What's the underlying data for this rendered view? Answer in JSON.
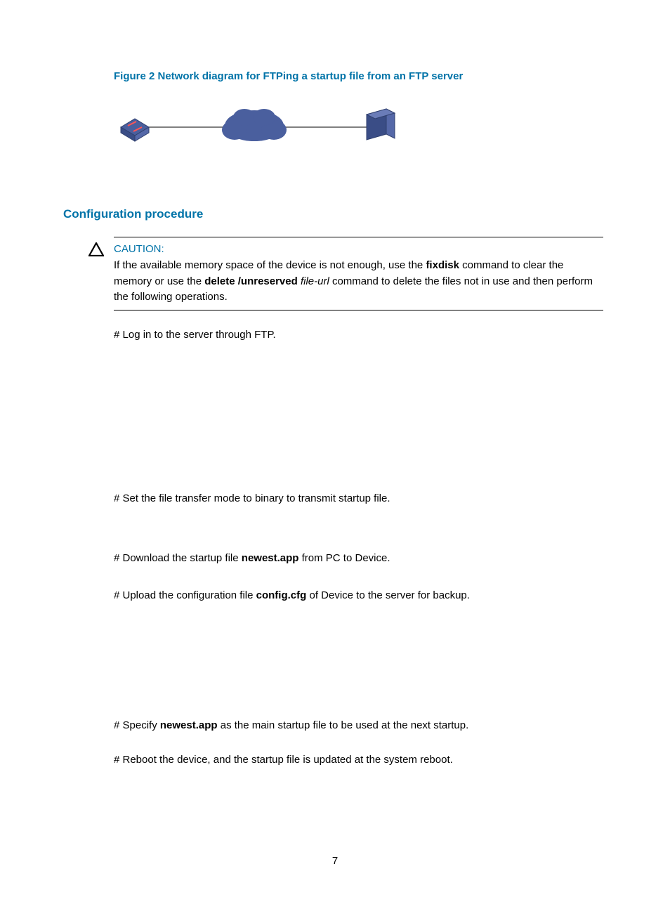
{
  "figure_title": "Figure 2 Network diagram for FTPing a startup file from an FTP server",
  "section_heading": "Configuration procedure",
  "caution": {
    "label": "CAUTION:",
    "text_pre": "If the available memory space of the device is not enough, use the ",
    "text_cmd1": "fixdisk",
    "text_mid1": " command to clear the memory or use the ",
    "text_cmd2": "delete /unreserved",
    "text_space": " ",
    "text_arg": "file-url",
    "text_post": " command to delete the files not in use and then perform the following operations."
  },
  "steps": {
    "s1": "# Log in to the server through FTP.",
    "s2": "# Set the file transfer mode to binary to transmit startup file.",
    "s3_pre": "# Download the startup file ",
    "s3_b": "newest.app",
    "s3_post": " from PC to Device.",
    "s4_pre": "# Upload the configuration file ",
    "s4_b": "config.cfg",
    "s4_post": " of Device to the server for backup.",
    "s5_pre": "# Specify ",
    "s5_b": "newest.app",
    "s5_post": " as the main startup file to be used at the next startup.",
    "s6": "# Reboot the device, and the startup file is updated at the system reboot."
  },
  "page_number": "7"
}
